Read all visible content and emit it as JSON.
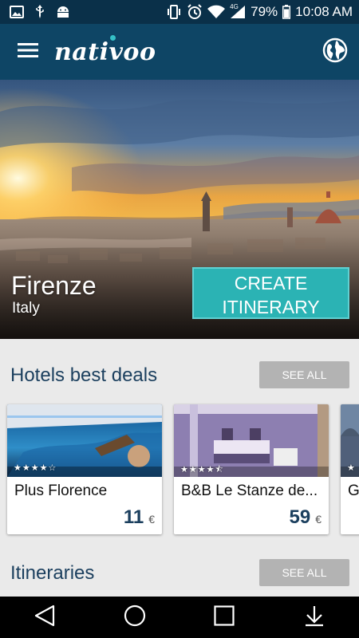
{
  "status_bar": {
    "battery": "79%",
    "time": "10:08 AM",
    "network": "4G",
    "icons": [
      "image-icon",
      "usb-icon",
      "android-icon",
      "vibrate-icon",
      "alarm-icon",
      "wifi-icon",
      "signal-icon",
      "battery-icon"
    ]
  },
  "app_bar": {
    "logo": "nativoo",
    "icons": [
      "menu-icon",
      "globe-icon"
    ]
  },
  "hero": {
    "city": "Firenze",
    "country": "Italy",
    "create_line1": "CREATE",
    "create_line2": "ITINERARY"
  },
  "hotels": {
    "title": "Hotels best deals",
    "see_all": "SEE ALL",
    "items": [
      {
        "name": "Plus Florence",
        "price": "11",
        "currency": "€",
        "rating": 4
      },
      {
        "name": "B&B Le Stanze de...",
        "price": "59",
        "currency": "€",
        "rating": 4.5
      },
      {
        "name": "G",
        "price": "",
        "currency": "",
        "rating": 1
      }
    ]
  },
  "itineraries": {
    "title": "Itineraries",
    "see_all": "SEE ALL"
  },
  "nav_bar": {
    "icons": [
      "back-icon",
      "home-icon",
      "recents-icon",
      "download-icon"
    ]
  },
  "colors": {
    "status_bar": "#0a3049",
    "app_bar": "#0e4565",
    "accent": "#2bb3b4",
    "title_text": "#1b3f5e",
    "content_bg": "#eaeaea"
  }
}
